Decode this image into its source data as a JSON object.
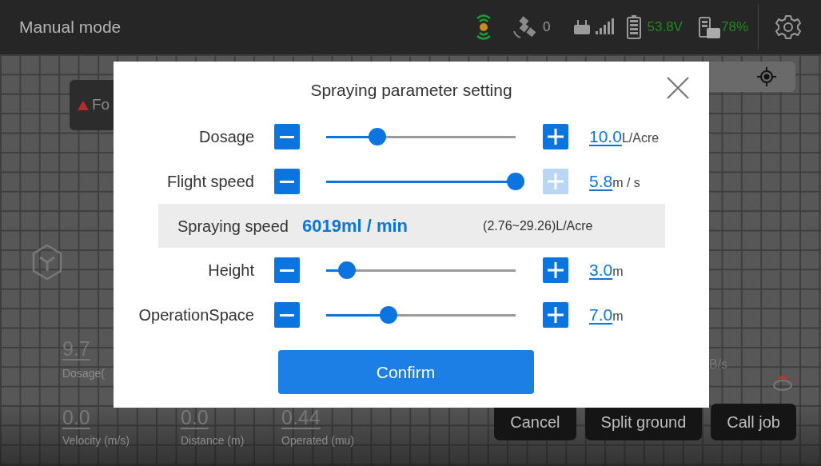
{
  "top_bar": {
    "title": "Manual mode",
    "satellites": "0",
    "voltage": "53.8V",
    "remote_battery": "78%"
  },
  "map": {
    "left_button": "Fo",
    "dosage_stat": {
      "value": "9.7",
      "label": "Dosage("
    },
    "bottom_stats": [
      {
        "value": "0.0",
        "label": "Velocity (m/s)"
      },
      {
        "value": "0.0",
        "label": "Distance (m)"
      },
      {
        "value": "0.44",
        "label": "Operated (mu)"
      }
    ],
    "rate_unit": "B/s",
    "actions": [
      {
        "label": "Cancel"
      },
      {
        "label": "Split ground"
      },
      {
        "label": "Call job"
      }
    ]
  },
  "dialog": {
    "title": "Spraying parameter setting",
    "rows": [
      {
        "kind": "slider",
        "label": "Dosage",
        "level": 0.27,
        "value": "10.0",
        "unit": "L/Acre",
        "plus_disabled": false
      },
      {
        "kind": "slider",
        "label": "Flight speed",
        "level": 1,
        "value": "5.8",
        "unit": "m / s",
        "plus_disabled": true
      },
      {
        "kind": "summary",
        "label": "Spraying speed",
        "value": "6019ml / min",
        "range": "(2.76~29.26)L/Acre"
      },
      {
        "kind": "slider",
        "label": "Height",
        "level": 0.11,
        "value": "3.0",
        "unit": "m",
        "plus_disabled": false
      },
      {
        "kind": "slider",
        "label": "OperationSpace",
        "level": 0.33,
        "value": "7.0",
        "unit": "m",
        "plus_disabled": false
      }
    ],
    "confirm": "Confirm"
  }
}
